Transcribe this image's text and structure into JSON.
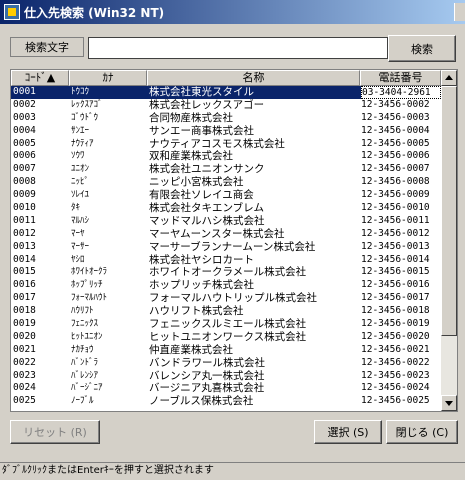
{
  "window": {
    "title": "仕入先検索 (Win32 NT)"
  },
  "search": {
    "label": "検索文字",
    "value": "",
    "button_label": "検索"
  },
  "columns": {
    "code": "ｺｰﾄﾞ▲",
    "kana": "ｶﾅ",
    "name": "名称",
    "tel": "電話番号"
  },
  "rows": [
    {
      "code": "0001",
      "kana": "ﾄｳｺｳ",
      "name": "株式会社東光スタイル",
      "tel": "03-3404-2961",
      "selected": true
    },
    {
      "code": "0002",
      "kana": "ﾚｯｸｽｱｺﾞ",
      "name": "株式会社レックスアゴー",
      "tel": "12-3456-0002"
    },
    {
      "code": "0003",
      "kana": "ｺﾞｳﾄﾞｳ",
      "name": "合同物産株式会社",
      "tel": "12-3456-0003"
    },
    {
      "code": "0004",
      "kana": "ｻﾝｴｰ",
      "name": "サンエー商事株式会社",
      "tel": "12-3456-0004"
    },
    {
      "code": "0005",
      "kana": "ﾅｳﾃｨｱ",
      "name": "ナウティアコスモス株式会社",
      "tel": "12-3456-0005"
    },
    {
      "code": "0006",
      "kana": "ｿｳﾜ",
      "name": "双和産業株式会社",
      "tel": "12-3456-0006"
    },
    {
      "code": "0007",
      "kana": "ﾕﾆｵﾝ",
      "name": "株式会社ユニオンサンク",
      "tel": "12-3456-0007"
    },
    {
      "code": "0008",
      "kana": "ﾆｯﾋﾟ",
      "name": "ニッピ小宮株式会社",
      "tel": "12-3456-0008"
    },
    {
      "code": "0009",
      "kana": "ｿﾚｲﾕ",
      "name": "有限会社ソレイユ商会",
      "tel": "12-3456-0009"
    },
    {
      "code": "0010",
      "kana": "ﾀｷ",
      "name": "株式会社タキエンブレム",
      "tel": "12-3456-0010"
    },
    {
      "code": "0011",
      "kana": "ﾏﾙﾊｼ",
      "name": "マッドマルハシ株式会社",
      "tel": "12-3456-0011"
    },
    {
      "code": "0012",
      "kana": "ﾏｰﾔ",
      "name": "マーヤムーンスター株式会社",
      "tel": "12-3456-0012"
    },
    {
      "code": "0013",
      "kana": "ﾏｰｻｰ",
      "name": "マーサーブランナームーン株式会社",
      "tel": "12-3456-0013"
    },
    {
      "code": "0014",
      "kana": "ﾔｼﾛ",
      "name": "株式会社ヤシロカート",
      "tel": "12-3456-0014"
    },
    {
      "code": "0015",
      "kana": "ﾎﾜｲﾄｵｰｸﾗ",
      "name": "ホワイトオークラメール株式会社",
      "tel": "12-3456-0015"
    },
    {
      "code": "0016",
      "kana": "ﾎｯﾌﾟﾘｯﾁ",
      "name": "ホップリッチ株式会社",
      "tel": "12-3456-0016"
    },
    {
      "code": "0017",
      "kana": "ﾌｫｰﾏﾙﾊｳﾄ",
      "name": "フォーマルハウトリップル株式会社",
      "tel": "12-3456-0017"
    },
    {
      "code": "0018",
      "kana": "ﾊｳﾘﾌﾄ",
      "name": "ハウリフト株式会社",
      "tel": "12-3456-0018"
    },
    {
      "code": "0019",
      "kana": "ﾌｪﾆｯｸｽ",
      "name": "フェニックスルミエール株式会社",
      "tel": "12-3456-0019"
    },
    {
      "code": "0020",
      "kana": "ﾋｯﾄﾕﾆｵﾝ",
      "name": "ヒットユニオンワークス株式会社",
      "tel": "12-3456-0020"
    },
    {
      "code": "0021",
      "kana": "ﾅｶﾁｮｳ",
      "name": "仲直産業株式会社",
      "tel": "12-3456-0021"
    },
    {
      "code": "0022",
      "kana": "ﾊﾞﾝﾄﾞﾗ",
      "name": "バンドラワール株式会社",
      "tel": "12-3456-0022"
    },
    {
      "code": "0023",
      "kana": "ﾊﾞﾚﾝｼｱ",
      "name": "バレンシア丸一株式会社",
      "tel": "12-3456-0023"
    },
    {
      "code": "0024",
      "kana": "ﾊﾞｰｼﾞﾆｱ",
      "name": "バージニア丸喜株式会社",
      "tel": "12-3456-0024"
    },
    {
      "code": "0025",
      "kana": "ﾉｰﾌﾞﾙ",
      "name": "ノーブルス保株式会社",
      "tel": "12-3456-0025"
    }
  ],
  "buttons": {
    "reset": "リセット (R)",
    "select": "選択 (S)",
    "close": "閉じる (C)"
  },
  "status": {
    "text": "ﾀﾞﾌﾞﾙｸﾘｯｸまたはEnterｷｰを押すと選択されます"
  }
}
